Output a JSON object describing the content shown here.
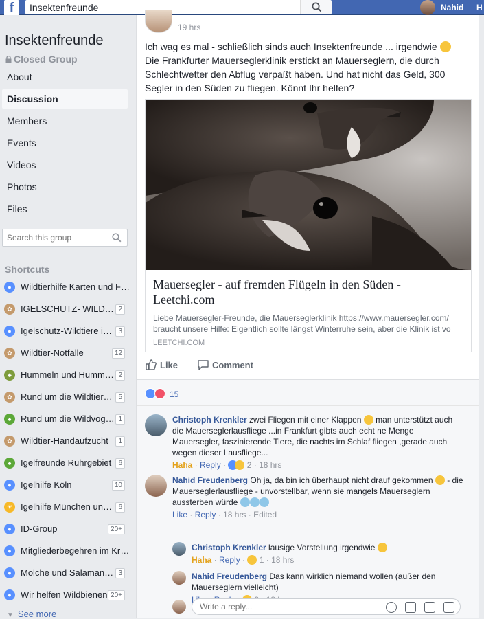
{
  "topbar": {
    "logo": "f",
    "search_value": "Insektenfreunde",
    "user_name": "Nahid",
    "home_label": "H"
  },
  "sidebar": {
    "group_name": "Insektenfreunde",
    "privacy": "Closed Group",
    "nav": [
      "About",
      "Discussion",
      "Members",
      "Events",
      "Videos",
      "Photos",
      "Files"
    ],
    "active_nav": "Discussion",
    "search_placeholder": "Search this group",
    "shortcuts_title": "Shortcuts",
    "shortcuts": [
      {
        "label": "Wildtierhilfe Karten und Fin...",
        "count": "",
        "icon": "group-icon",
        "color": "#5890ff"
      },
      {
        "label": "IGELSCHUTZ- WILDTIER...",
        "count": "2",
        "icon": "paw-icon",
        "color": "#c49a6c"
      },
      {
        "label": "Igelschutz-Wildtiere in Not",
        "count": "3",
        "icon": "group-icon",
        "color": "#5890ff"
      },
      {
        "label": "Wildtier-Notfälle",
        "count": "12",
        "icon": "paw-icon",
        "color": "#c49a6c"
      },
      {
        "label": "Hummeln und Hummelnestr...",
        "count": "2",
        "icon": "plant-icon",
        "color": "#7e9c3c"
      },
      {
        "label": "Rund um die Wildtierhilfe",
        "count": "5",
        "icon": "paw-icon",
        "color": "#c49a6c"
      },
      {
        "label": "Rund um die Wildvogelhilfe",
        "count": "1",
        "icon": "tree-icon",
        "color": "#5ca838"
      },
      {
        "label": "Wildtier-Handaufzucht",
        "count": "1",
        "icon": "paw-icon",
        "color": "#c49a6c"
      },
      {
        "label": "Igelfreunde Ruhrgebiet",
        "count": "6",
        "icon": "tree-icon",
        "color": "#5ca838"
      },
      {
        "label": "Igelhilfe Köln",
        "count": "10",
        "icon": "group-icon",
        "color": "#5890ff"
      },
      {
        "label": "Igelhilfe München und Um...",
        "count": "6",
        "icon": "sun-icon",
        "color": "#f7b928"
      },
      {
        "label": "ID-Group",
        "count": "20+",
        "icon": "group-icon",
        "color": "#5890ff"
      },
      {
        "label": "Mitgliederbegehren im Kreis...",
        "count": "",
        "icon": "group-icon",
        "color": "#5890ff"
      },
      {
        "label": "Molche und Salamander",
        "count": "3",
        "icon": "group-icon",
        "color": "#5890ff"
      },
      {
        "label": "Wir helfen Wildbienen",
        "count": "20+",
        "icon": "group-icon",
        "color": "#5890ff"
      }
    ],
    "see_more": "See more"
  },
  "post": {
    "time": "19 hrs",
    "text_line1": "Ich wag es mal - schließlich sinds auch Insektenfreunde ... irgendwie",
    "text_rest": "Die Frankfurter Mauerseglerklinik erstickt an Mauerseglern, die durch Schlechtwetter den Abflug verpaßt haben. Und hat nicht das Geld, 300 Segler in den Süden zu fliegen. Könnt Ihr helfen?",
    "link": {
      "title": "Mauersegler - auf fremden Flügeln in den Süden - Leetchi.com",
      "description": "Liebe Mauersegler-Freunde, die Mauerseglerklinik https://www.mauersegler.com/ braucht unsere Hilfe: Eigentlich sollte längst Winterruhe sein, aber die Klinik ist vo",
      "domain": "LEETCHI.COM"
    },
    "like_label": "Like",
    "comment_label": "Comment",
    "reaction_count": "15"
  },
  "comments": [
    {
      "name": "Christoph Krenkler",
      "text": "zwei Fliegen mit einer Klappen",
      "text2": "man unterstützt auch die Mauerseglerlausfliege ...in Frankfurt gibts auch echt ne Menge Mauersegler, faszinierende Tiere, die nachts im Schlaf fliegen ,gerade auch wegen dieser Lausfliege...",
      "reaction_label": "Haha",
      "reply_label": "Reply",
      "reactions": "2",
      "time": "18 hrs"
    },
    {
      "name": "Nahid Freudenberg",
      "text": "Oh ja, da bin ich überhaupt nicht drauf gekommen",
      "text2": "- die Mauerseglerlausfliege - unvorstellbar, wenn sie mangels Mauerseglern aussterben würde",
      "like_label": "Like",
      "reply_label": "Reply",
      "time": "18 hrs",
      "edited": "Edited"
    }
  ],
  "replies": [
    {
      "name": "Christoph Krenkler",
      "text": "lausige Vorstellung irgendwie",
      "reaction_label": "Haha",
      "reply_label": "Reply",
      "reactions": "1",
      "time": "18 hrs"
    },
    {
      "name": "Nahid Freudenberg",
      "text": "Das kann wirklich niemand wollen (außer den Mauerseglern vielleicht)",
      "like_label": "Like",
      "reply_label": "Reply",
      "reactions": "2",
      "time": "18 hrs"
    }
  ],
  "reply_placeholder": "Write a reply...",
  "colors": {
    "brand": "#4267b2",
    "link": "#365899",
    "haha": "#e3a21b",
    "background": "#e9ebee"
  }
}
